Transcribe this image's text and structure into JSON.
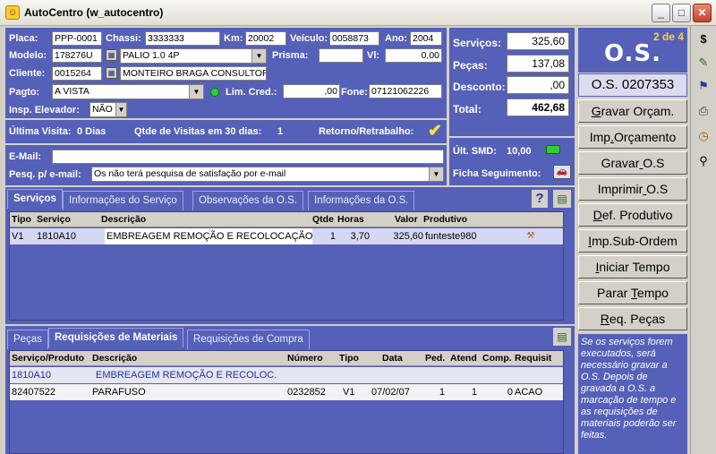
{
  "window": {
    "title": "AutoCentro (w_autocentro)",
    "buttons": {
      "minimize": "_",
      "maximize": "□",
      "close": "✕"
    }
  },
  "vehicle": {
    "placa_label": "Placa:",
    "placa": "PPP-0001",
    "chassi_label": "Chassi:",
    "chassi": "3333333",
    "km_label": "Km:",
    "km": "20002",
    "veiculo_label": "Veículo:",
    "veiculo": "0058873",
    "ano_label": "Ano:",
    "ano": "2004",
    "modelo_label": "Modelo:",
    "modelo_code": "178276U",
    "modelo": "PALIO 1.0 4P",
    "prisma_label": "Prisma:",
    "prisma": "",
    "vl_label": "Vl:",
    "vl": "0,00",
    "cliente_label": "Cliente:",
    "cliente_code": "0015264",
    "cliente": "MONTEIRO BRAGA CONSULTORIA",
    "pagto_label": "Pagto:",
    "pagto": "A VISTA",
    "limcred_label": "Lim. Cred.:",
    "limcred": ",00",
    "fone_label": "Fone:",
    "fone": "07121062226",
    "elevador_label": "Insp. Elevador:",
    "elevador": "NÃO"
  },
  "visits": {
    "ultima_label": "Última Visita:",
    "ultima": "0 Dias",
    "qtde_label": "Qtde de Visitas em 30 dias:",
    "qtde": "1",
    "retorno_label": "Retorno/Retrabalho:",
    "retorno_mark": "✔"
  },
  "email": {
    "email_label": "E-Mail:",
    "email": "",
    "pesq_label": "Pesq. p/ e-mail:",
    "pesq": "Os não terá pesquisa de satisfação por e-mail"
  },
  "summary": {
    "servicos_label": "Serviços:",
    "servicos": "325,60",
    "pecas_label": "Peças:",
    "pecas": "137,08",
    "desconto_label": "Desconto:",
    "desconto": ",00",
    "total_label": "Total:",
    "total": "462,68",
    "smd_label": "Últ. SMD:",
    "smd": "10,00",
    "ficha_label": "Ficha Seguimento:"
  },
  "os": {
    "counter": "2 de 4",
    "heading": "O.S.",
    "number": "O.S. 0207353"
  },
  "actions": [
    {
      "label": "Gravar Orçam."
    },
    {
      "label": "Imp.Orçamento"
    },
    {
      "label": "Gravar O.S"
    },
    {
      "label": "Imprimir O.S"
    },
    {
      "label": "Def. Produtivo"
    },
    {
      "label": "Imp.Sub-Ordem"
    },
    {
      "label": "Iniciar Tempo"
    },
    {
      "label": "Parar Tempo"
    },
    {
      "label": "Req. Peças"
    }
  ],
  "help_text": "Se os serviços forem executados, será necessário gravar a O.S. Depois de gravada a O.S. a marcação de tempo e as requisições de materiais poderão ser feitas.",
  "toolbar": {
    "dollar": "$",
    "edit": "✎",
    "flag": "⚑",
    "print": "⎙",
    "clock": "◷",
    "binoculars": "⚲"
  },
  "services_tabs": [
    "Serviços",
    "Informações do Serviço",
    "Observações da O.S.",
    "Informações da O.S."
  ],
  "services_help": "?",
  "services_grid": {
    "columns": [
      "Tipo",
      "Serviço",
      "Descrição",
      "Qtde",
      "Horas",
      "Valor",
      "Produtivo"
    ],
    "rows": [
      {
        "tipo": "V1",
        "servico": "1810A10",
        "descricao": "EMBREAGEM REMOÇÃO E RECOLOCAÇÃO",
        "qtde": "1",
        "horas": "3,70",
        "valor": "325,60",
        "produtivo": "funteste980"
      }
    ]
  },
  "materials_tabs": [
    "Peças",
    "Requisições de Materiais",
    "Requisições de Compra"
  ],
  "materials_grid": {
    "columns": [
      "Serviço/Produto",
      "Descrição",
      "Número",
      "Tipo",
      "Data",
      "Ped.",
      "Atend",
      "Comp.",
      "Requisit"
    ],
    "rows": [
      {
        "produto": "1810A10",
        "descricao": "EMBREAGEM REMOÇÃO E RECOLOC.",
        "numero": "",
        "tipo": "",
        "data": "",
        "ped": "",
        "atend": "",
        "comp": "",
        "requisit": ""
      },
      {
        "produto": "82407522",
        "descricao": "PARAFUSO",
        "numero": "0232852",
        "tipo": "V1",
        "data": "07/02/07",
        "ped": "1",
        "atend": "1",
        "comp": "0",
        "requisit": "ACAO"
      }
    ]
  }
}
